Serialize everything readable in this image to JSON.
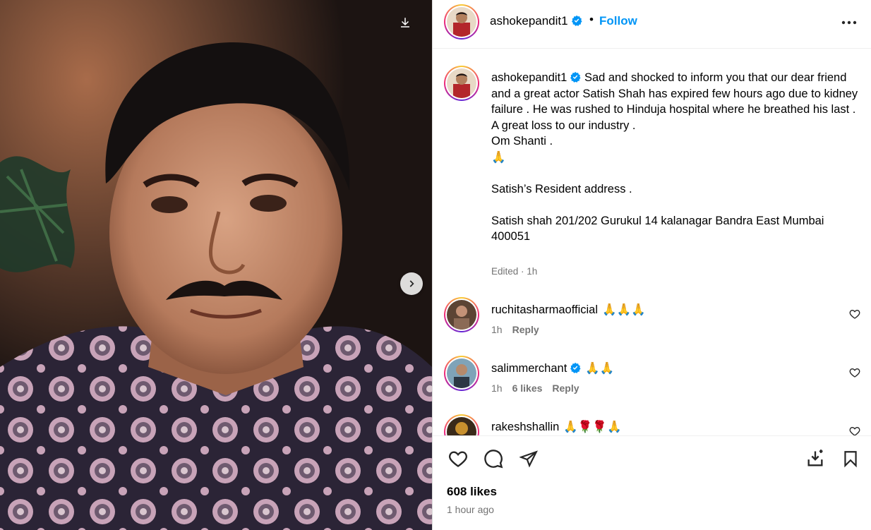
{
  "post": {
    "author": "ashokepandit1",
    "verified": true,
    "follow_label": "Follow",
    "separator": "•"
  },
  "caption": {
    "lines": [
      "Sad and shocked to inform you that our dear friend and a great actor Satish Shah has expired few hours ago due to kidney failure . He was rushed to Hinduja hospital where he breathed his last .",
      "A great loss to our industry .",
      "Om Shanti .",
      "🙏",
      "",
      "Satish’s Resident address .",
      "",
      "Satish shah 201/202 Gurukul 14 kalanagar Bandra East Mumbai 400051"
    ],
    "meta": "Edited · 1h"
  },
  "comments": [
    {
      "user": "ruchitasharmaofficial",
      "verified": false,
      "text": "🙏🙏🙏",
      "time": "1h",
      "likes": "",
      "reply": "Reply"
    },
    {
      "user": "salimmerchant",
      "verified": true,
      "text": "🙏🙏",
      "time": "1h",
      "likes": "6 likes",
      "reply": "Reply"
    },
    {
      "user": "rakeshshallin",
      "verified": false,
      "text": "🙏🌹🌹🙏",
      "time": "",
      "likes": "",
      "reply": ""
    }
  ],
  "footer": {
    "likes": "608 likes",
    "posted": "1 hour ago"
  },
  "icons": {
    "download": "download-icon",
    "next": "chevron-right-icon",
    "more": "more-options-icon",
    "like": "heart-icon",
    "comment": "comment-icon",
    "share": "share-icon",
    "save": "bookmark-icon",
    "save_collection": "save-to-collection-icon"
  },
  "colors": {
    "follow": "#0095f6",
    "verified": "#0095f6",
    "muted": "#737373"
  }
}
